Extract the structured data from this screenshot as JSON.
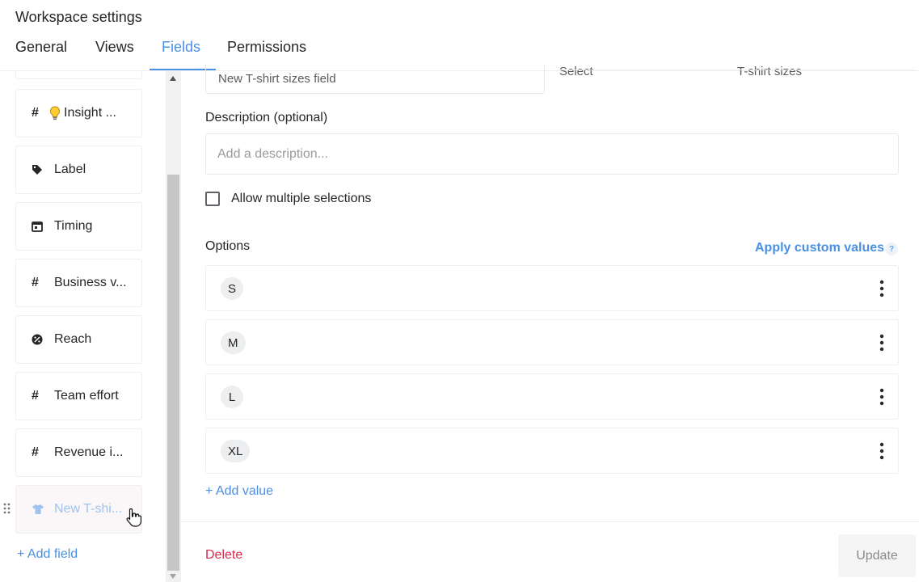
{
  "header": {
    "title": "Workspace settings",
    "tabs": [
      {
        "label": "General",
        "active": false
      },
      {
        "label": "Views",
        "active": false
      },
      {
        "label": "Fields",
        "active": true
      },
      {
        "label": "Permissions",
        "active": false
      }
    ]
  },
  "sidebar": {
    "fields": [
      {
        "label": "Insight ...",
        "icon": "hash-icon",
        "emoji": "lightbulb-icon"
      },
      {
        "label": "Label",
        "icon": "tag-icon"
      },
      {
        "label": "Timing",
        "icon": "calendar-icon"
      },
      {
        "label": "Business v...",
        "icon": "hash-icon"
      },
      {
        "label": "Reach",
        "icon": "percent-icon"
      },
      {
        "label": "Team effort",
        "icon": "hash-icon"
      },
      {
        "label": "Revenue i...",
        "icon": "hash-icon"
      },
      {
        "label": "New T-shi...",
        "icon": "tshirt-icon",
        "dragging": true
      }
    ],
    "add_field": "+ Add field"
  },
  "form": {
    "name_value": "New T-shirt sizes field",
    "type_value": "Select",
    "sizes_value": "T-shirt sizes",
    "description_label": "Description (optional)",
    "description_placeholder": "Add a description...",
    "allow_multiple_label": "Allow multiple selections",
    "allow_multiple_checked": false,
    "options_label": "Options",
    "apply_custom_values": "Apply custom values",
    "help_glyph": "?",
    "options": [
      "S",
      "M",
      "L",
      "XL"
    ],
    "add_value": "+ Add value"
  },
  "footer": {
    "delete_label": "Delete",
    "update_label": "Update"
  },
  "colors": {
    "accent": "#4a90e2",
    "danger": "#d6294a",
    "text": "#262626"
  }
}
